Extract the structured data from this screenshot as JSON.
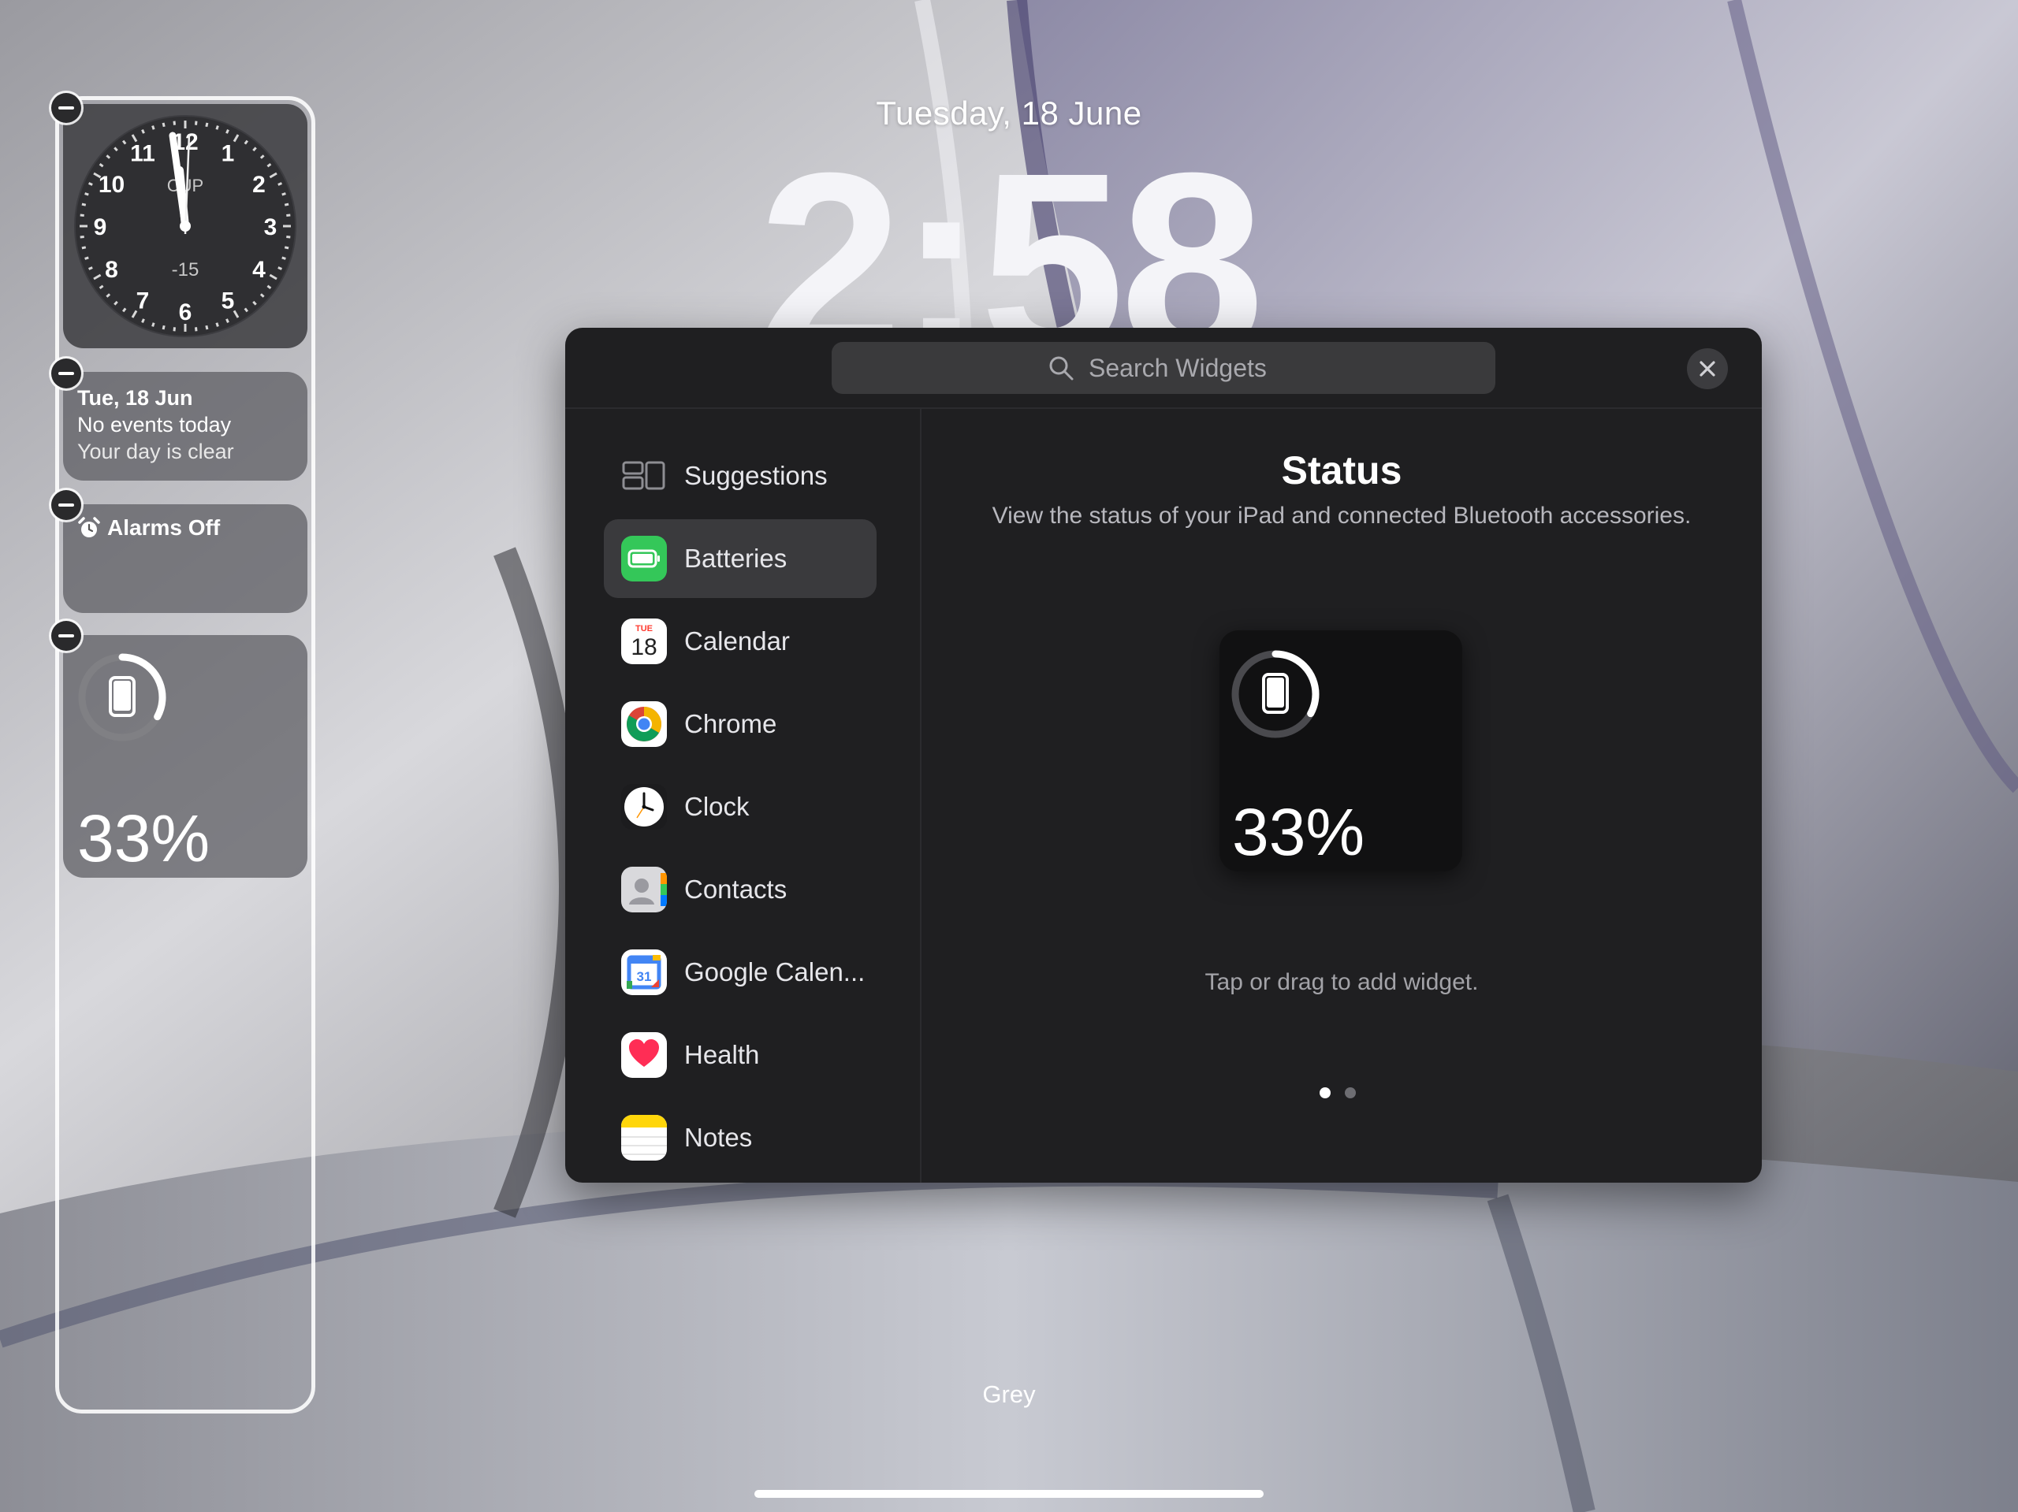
{
  "lockscreen": {
    "date": "Tuesday, 18 June",
    "time": "2:58",
    "wallpaper_name": "Grey"
  },
  "widgets": {
    "clock": {
      "city": "CUP",
      "offset": "-15",
      "numbers": [
        "12",
        "1",
        "2",
        "3",
        "4",
        "5",
        "6",
        "7",
        "8",
        "9",
        "10",
        "11"
      ]
    },
    "calendar": {
      "date": "Tue, 18 Jun",
      "events": "No events today",
      "subtitle": "Your day is clear"
    },
    "alarm": {
      "label": "Alarms Off"
    },
    "battery": {
      "percent": "33%",
      "level": 0.33
    }
  },
  "gallery": {
    "search_placeholder": "Search Widgets",
    "sidebar": [
      {
        "label": "Suggestions",
        "icon": "suggestions-icon"
      },
      {
        "label": "Batteries",
        "icon": "batteries-app-icon"
      },
      {
        "label": "Calendar",
        "icon": "calendar-app-icon"
      },
      {
        "label": "Chrome",
        "icon": "chrome-app-icon"
      },
      {
        "label": "Clock",
        "icon": "clock-app-icon"
      },
      {
        "label": "Contacts",
        "icon": "contacts-app-icon"
      },
      {
        "label": "Google Calen...",
        "icon": "google-calendar-app-icon"
      },
      {
        "label": "Health",
        "icon": "health-app-icon"
      },
      {
        "label": "Notes",
        "icon": "notes-app-icon"
      }
    ],
    "calendar_icon": {
      "day": "TUE",
      "date": "18"
    },
    "gcal_icon": {
      "date": "31"
    },
    "detail": {
      "title": "Status",
      "description": "View the status of your iPad and connected Bluetooth accessories.",
      "preview_percent": "33%",
      "hint": "Tap or drag to add widget."
    },
    "page_count": 2,
    "current_page": 1
  },
  "colors": {
    "panel_bg": "#1f1f21",
    "batteries_green": "#34c759",
    "health_red": "#ff2d55",
    "notes_yellow": "#ffd60a"
  }
}
